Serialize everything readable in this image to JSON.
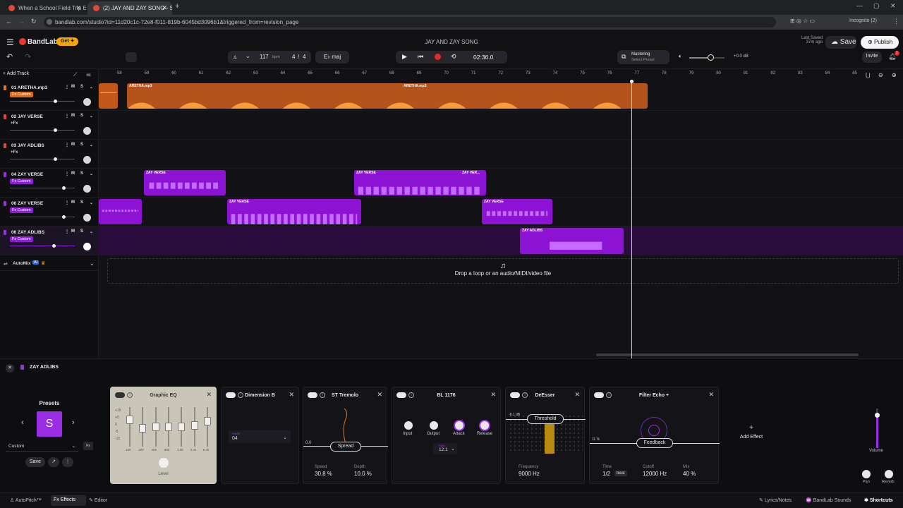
{
  "browser": {
    "tabs": [
      {
        "title": "When a School Field Trip Ends"
      },
      {
        "title": "(2) JAY AND ZAY SONG - S"
      }
    ],
    "url": "bandlab.com/studio?id=11d20c1c-72e8-f011-819b-6045bd3096b1&triggered_from=revision_page",
    "profile": "Incognito (2)"
  },
  "header": {
    "logo": "BandLab",
    "get_label": "Get",
    "project_title": "JAY AND ZAY SONG",
    "last_saved_label": "Last Saved",
    "last_saved_time": "37m ago",
    "save_label": "Save",
    "publish_label": "Publish",
    "invite_label": "Invite",
    "notif_count": "1"
  },
  "transport": {
    "bpm": "117",
    "bpm_unit": "bpm",
    "time_sig_num": "4",
    "time_sig_den": "4",
    "key": "E♭ maj",
    "time": "02:36.0",
    "mastering_label": "Mastering",
    "mastering_preset": "Select Preset",
    "master_db": "+0.0 dB"
  },
  "tracks_header": {
    "add_track": "Add Track"
  },
  "ruler": [
    "58",
    "59",
    "60",
    "61",
    "62",
    "63",
    "64",
    "65",
    "66",
    "67",
    "68",
    "69",
    "70",
    "71",
    "72",
    "73",
    "74",
    "75",
    "76",
    "77",
    "78",
    "79",
    "80",
    "81",
    "82",
    "83",
    "84",
    "85"
  ],
  "tracks": [
    {
      "name": "01  ARETHA.mp3",
      "tag": "Fx Custom",
      "tag_color": "#e06a1a",
      "color": "#e8731f"
    },
    {
      "name": "02  JAY VERSE",
      "tag": "+Fx",
      "color": "#d44"
    },
    {
      "name": "03  JAY ADLIBS",
      "tag": "+Fx",
      "color": "#d44"
    },
    {
      "name": "04  ZAY VERSE",
      "tag": "Fx Custom",
      "tag_color": "#8a1fd6",
      "color": "#9a2ee6"
    },
    {
      "name": "06  ZAY VERSE",
      "tag": "Fx Custom",
      "tag_color": "#8a1fd6",
      "color": "#9a2ee6"
    },
    {
      "name": "06  ZAY ADLIBS",
      "tag": "Fx Custom",
      "tag_color": "#8a1fd6",
      "color": "#9a2ee6"
    }
  ],
  "mute_label": "M",
  "solo_label": "S",
  "clips": {
    "aretha_label": "ARETHA.mp3",
    "zay_verse_label": "ZAY VERSE",
    "zay_verse_short": "ZAY VER...",
    "zay_adlibs_label": "ZAY ADLIBS"
  },
  "automix": {
    "label": "AutoMix",
    "ai_badge": "AI"
  },
  "dropzone": {
    "text": "Drop a loop or an audio/MIDI/video file"
  },
  "fx_panel": {
    "track_name": "ZAY ADLIBS",
    "presets_label": "Presets",
    "preset_letter": "S",
    "preset_name": "Custom",
    "save_label": "Save",
    "add_effect": "Add Effect",
    "volume_label": "Volume",
    "pan_label": "Pan",
    "reverb_label": "Reverb"
  },
  "effects": {
    "geq": {
      "title": "Graphic EQ",
      "bands": [
        "100",
        "200",
        "400",
        "800",
        "1.6k",
        "3.2k",
        "6.4k"
      ],
      "scale": [
        "+15",
        "+5",
        "0",
        "-5",
        "-15"
      ],
      "level_label": "Level"
    },
    "dimb": {
      "title": "Dimension B",
      "mode_label": "Mode",
      "mode_value": "04"
    },
    "trem": {
      "title": "ST Tremolo",
      "spread": "Spread",
      "zero": "0.0",
      "speed_label": "Speed",
      "speed_value": "30.8 %",
      "depth_label": "Depth",
      "depth_value": "10.0 %"
    },
    "bl": {
      "title": "BL 1176",
      "input": "Input",
      "output": "Output",
      "attack": "Attack",
      "release": "Release",
      "ratio_label": "Ratio",
      "ratio_value": "12:1"
    },
    "deesser": {
      "title": "DeEsser",
      "threshold": "Threshold",
      "db": "-8.1 dB",
      "freq_label": "Frequency",
      "freq_value": "9000 Hz"
    },
    "echo": {
      "title": "Filter Echo +",
      "feedback": "Feedback",
      "pct": "11 %",
      "time_label": "Time",
      "time_value": "1/2",
      "time_unit": "beat",
      "cutoff_label": "Cutoff",
      "cutoff_value": "12000 Hz",
      "mix_label": "Mix",
      "mix_value": "40 %"
    }
  },
  "bottom": {
    "autopitch": "AutoPitch™",
    "effects": "Effects",
    "editor": "Editor",
    "lyrics": "Lyrics/Notes",
    "sounds": "BandLab Sounds",
    "shortcuts": "Shortcuts"
  }
}
